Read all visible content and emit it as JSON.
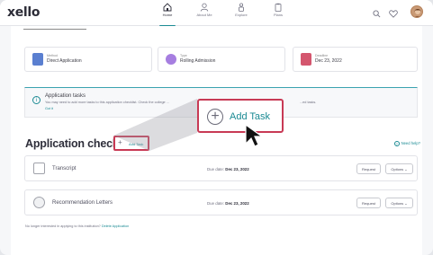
{
  "app": {
    "logo": "xello"
  },
  "nav": [
    {
      "label": "Home",
      "icon": "home-icon",
      "active": true
    },
    {
      "label": "About Me",
      "icon": "user-icon",
      "active": false
    },
    {
      "label": "Explore",
      "icon": "explore-icon",
      "active": false
    },
    {
      "label": "Plans",
      "icon": "clipboard-icon",
      "active": false
    }
  ],
  "top_icons": [
    "search-icon",
    "heart-icon",
    "avatar"
  ],
  "info": {
    "method": {
      "label": "Method",
      "value": "Direct Application"
    },
    "type": {
      "label": "Type",
      "value": "Rolling Admission"
    },
    "deadline": {
      "label": "Deadline",
      "value": "Dec 23, 2022"
    }
  },
  "alert": {
    "title": "Application tasks",
    "desc": "You may need to add more tasks to this application checklist. Check the college ...",
    "desc_end": "...ed tasks.",
    "link": "Got it"
  },
  "checklist": {
    "title": "Application checklist",
    "add_task": "Add Task",
    "need_help": "Need help?"
  },
  "tasks": [
    {
      "name": "Transcript",
      "due_label": "Due date:",
      "due": "Dec 23, 2022",
      "request": "Request",
      "options": "Options"
    },
    {
      "name": "Recommendation Letters",
      "due_label": "Due date:",
      "due": "Dec 23, 2022",
      "request": "Request",
      "options": "Options"
    }
  ],
  "footer": {
    "text": "No longer interested in applying to this institution?",
    "link": "Delete Application"
  },
  "zoom": {
    "label": "Add Task"
  },
  "colors": {
    "accent": "#1a8a93",
    "highlight": "#c83a55"
  }
}
